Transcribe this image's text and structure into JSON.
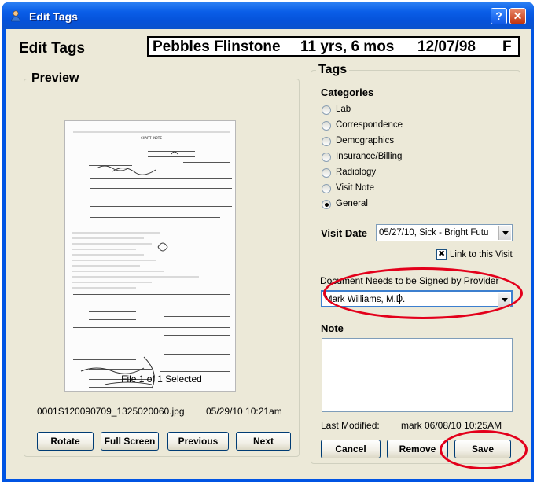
{
  "window": {
    "title": "Edit Tags",
    "help_label": "?",
    "close_label": "✕"
  },
  "header": {
    "title": "Edit Tags",
    "patient_name": "Pebbles Flinstone",
    "patient_age": "11 yrs, 6 mos",
    "patient_dob": "12/07/98",
    "patient_sex": "F"
  },
  "preview": {
    "label": "Preview",
    "document_title": "CHART NOTE",
    "file_count": "File 1 of 1 Selected",
    "file_name": "0001S120090709_1325020060.jpg",
    "file_date": "05/29/10 10:21am",
    "buttons": {
      "rotate": "Rotate",
      "full_screen": "Full Screen",
      "previous": "Previous",
      "next": "Next"
    }
  },
  "tags": {
    "label": "Tags",
    "categories_label": "Categories",
    "categories": [
      {
        "label": "Lab",
        "selected": false
      },
      {
        "label": "Correspondence",
        "selected": false
      },
      {
        "label": "Demographics",
        "selected": false
      },
      {
        "label": "Insurance/Billing",
        "selected": false
      },
      {
        "label": "Radiology",
        "selected": false
      },
      {
        "label": "Visit Note",
        "selected": false
      },
      {
        "label": "General",
        "selected": true
      }
    ],
    "visit_date_label": "Visit Date",
    "visit_date_value": "05/27/10, Sick - Bright Futu",
    "link_to_visit_label": "Link to this Visit",
    "link_to_visit_checked": true,
    "provider_label": "Document Needs to be Signed by Provider",
    "provider_value": "Mark Williams, M.D.",
    "note_label": "Note",
    "note_value": "",
    "last_modified_label": "Last Modified:",
    "last_modified_value": "mark 06/08/10 10:25AM",
    "buttons": {
      "cancel": "Cancel",
      "remove": "Remove",
      "save": "Save"
    }
  },
  "colors": {
    "titlebar": "#0a5ee8",
    "dialog_bg": "#ece9d8",
    "highlight_ellipse": "#e3001b",
    "combo_border": "#7f9db9"
  }
}
